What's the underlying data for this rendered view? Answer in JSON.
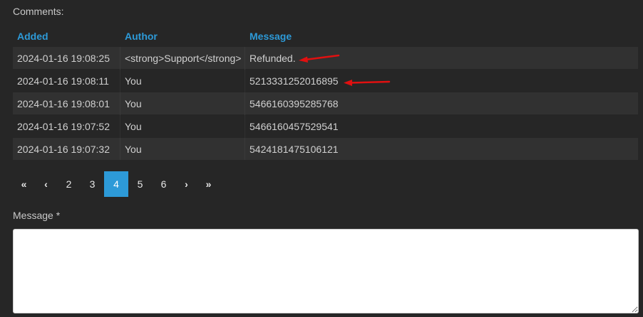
{
  "comments_label": "Comments:",
  "table": {
    "headers": [
      "Added",
      "Author",
      "Message"
    ],
    "rows": [
      {
        "added": "2024-01-16 19:08:25",
        "author": "<strong>Support</strong>",
        "message": "Refunded."
      },
      {
        "added": "2024-01-16 19:08:11",
        "author": "You",
        "message": "5213331252016895"
      },
      {
        "added": "2024-01-16 19:08:01",
        "author": "You",
        "message": "5466160395285768"
      },
      {
        "added": "2024-01-16 19:07:52",
        "author": "You",
        "message": "5466160457529541"
      },
      {
        "added": "2024-01-16 19:07:32",
        "author": "You",
        "message": "5424181475106121"
      }
    ]
  },
  "pagination": {
    "first": "«",
    "prev": "‹",
    "pages": [
      "2",
      "3",
      "4",
      "5",
      "6"
    ],
    "active_page": "4",
    "next": "›",
    "last": "»"
  },
  "message_form": {
    "label": "Message *",
    "value": ""
  },
  "colors": {
    "background": "#262626",
    "accent": "#2d9ad8",
    "annotation_arrow": "#e01010"
  }
}
